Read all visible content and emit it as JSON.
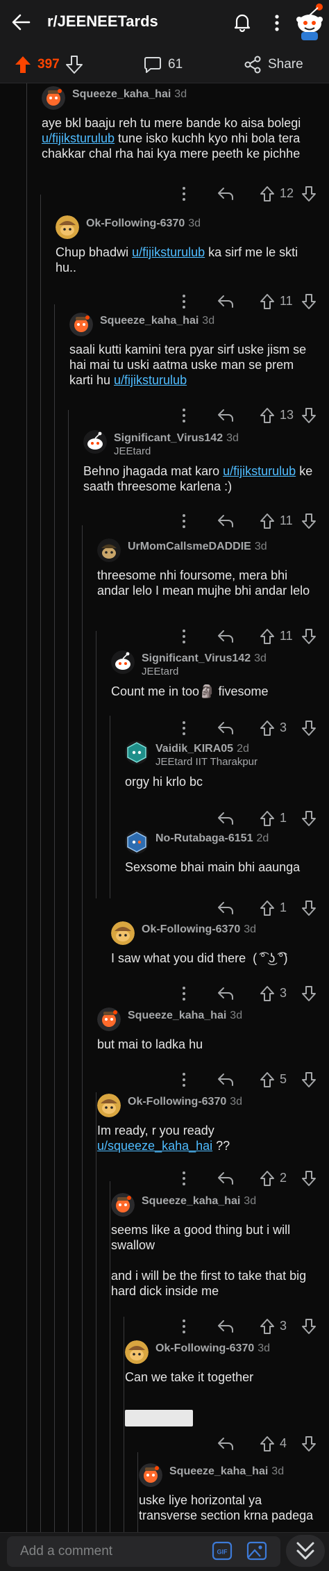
{
  "header": {
    "title": "r/JEENEETards"
  },
  "post_bar": {
    "score": "397",
    "comments": "61",
    "share_label": "Share"
  },
  "colors": {
    "upvote": "#ff4500",
    "link": "#4fbcff",
    "bg": "#0b0b0b"
  },
  "comments": [
    {
      "user": "Squeeze_kaha_hai",
      "time": "3d",
      "flair": "",
      "body": [
        "aye bkl baaju reh tu mere bande ko aisa bolegi ",
        "u/fijiksturulub",
        " tune isko kuchh kyo nhi bola tera chakkar chal rha hai kya mere peeth ke pichhe"
      ],
      "votes": "12"
    },
    {
      "user": "Ok-Following-6370",
      "time": "3d",
      "flair": "",
      "body": [
        "Chup bhadwi ",
        "u/fijiksturulub",
        " ka sirf me le skti hu.."
      ],
      "votes": "11"
    },
    {
      "user": "Squeeze_kaha_hai",
      "time": "3d",
      "flair": "",
      "body": [
        "saali kutti kamini tera pyar sirf uske jism se hai mai tu uski aatma uske man se prem karti hu ",
        "u/fijiksturulub",
        ""
      ],
      "votes": "13"
    },
    {
      "user": "Significant_Virus142",
      "time": "3d",
      "flair": "JEEtard",
      "body": [
        "Behno jhagada mat karo ",
        "u/fijiksturulub",
        " ke saath threesome karlena :)"
      ],
      "votes": "11"
    },
    {
      "user": "UrMomCallsmeDADDIE",
      "time": "3d",
      "flair": "",
      "body": [
        "threesome nhi foursome, mera bhi andar lelo I mean mujhe bhi andar lelo",
        "",
        ""
      ],
      "votes": "11"
    },
    {
      "user": "Significant_Virus142",
      "time": "3d",
      "flair": "JEEtard",
      "body": [
        "Count me in too🗿 fivesome",
        "",
        ""
      ],
      "votes": "3"
    },
    {
      "user": "Vaidik_KIRA05",
      "time": "2d",
      "flair": "JEEtard IIT Tharakpur",
      "body": [
        "orgy hi krlo bc",
        "",
        ""
      ],
      "votes": "1"
    },
    {
      "user": "No-Rutabaga-6151",
      "time": "2d",
      "flair": "",
      "body": [
        "Sexsome bhai main bhi aaunga",
        "",
        ""
      ],
      "votes": "1"
    },
    {
      "user": "Ok-Following-6370",
      "time": "3d",
      "flair": "",
      "body": [
        "I saw what you did there  ( ͡° ͜ʖ ͡°)",
        "",
        ""
      ],
      "votes": "3"
    },
    {
      "user": "Squeeze_kaha_hai",
      "time": "3d",
      "flair": "",
      "body": [
        "but mai to ladka hu",
        "",
        ""
      ],
      "votes": "5"
    },
    {
      "user": "Ok-Following-6370",
      "time": "3d",
      "flair": "",
      "body": [
        "Im ready, r you ready  ",
        "u/squeeze_kaha_hai",
        " ??"
      ],
      "votes": "2"
    },
    {
      "user": "Squeeze_kaha_hai",
      "time": "3d",
      "flair": "",
      "body": [
        "seems like a good thing but i will swallow\n\nand i will be the first to take that big hard dick inside me",
        "",
        ""
      ],
      "votes": "3"
    },
    {
      "user": "Ok-Following-6370",
      "time": "3d",
      "flair": "",
      "body": [
        "Can we take it together",
        "",
        ""
      ],
      "votes": "4"
    },
    {
      "user": "Squeeze_kaha_hai",
      "time": "3d",
      "flair": "",
      "body": [
        "uske liye horizontal ya transverse section krna padega",
        "",
        ""
      ],
      "votes": ""
    }
  ],
  "composer": {
    "placeholder": "Add a comment",
    "gif_label": "GIF"
  },
  "icons": {
    "back": "back-arrow-icon",
    "bell": "bell-icon",
    "more": "more-vertical-icon",
    "upvote": "upvote-icon",
    "downvote": "downvote-icon",
    "comment": "comment-icon",
    "share": "share-icon",
    "reply": "reply-icon",
    "gif": "gif-icon",
    "image": "image-icon",
    "collapse": "chevron-down-double-icon"
  }
}
